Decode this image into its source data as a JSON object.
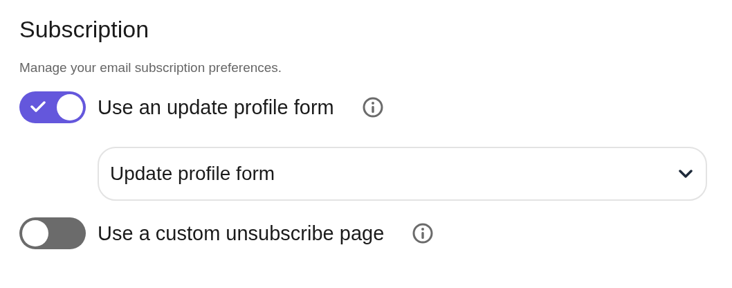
{
  "title": "Subscription",
  "description": "Manage your email subscription preferences.",
  "items": [
    {
      "kind": "toggle",
      "label": "Use an update profile form",
      "on": true
    },
    {
      "kind": "select",
      "value": "Update profile form"
    },
    {
      "kind": "toggle",
      "label": "Use a custom unsubscribe page",
      "on": false
    }
  ]
}
